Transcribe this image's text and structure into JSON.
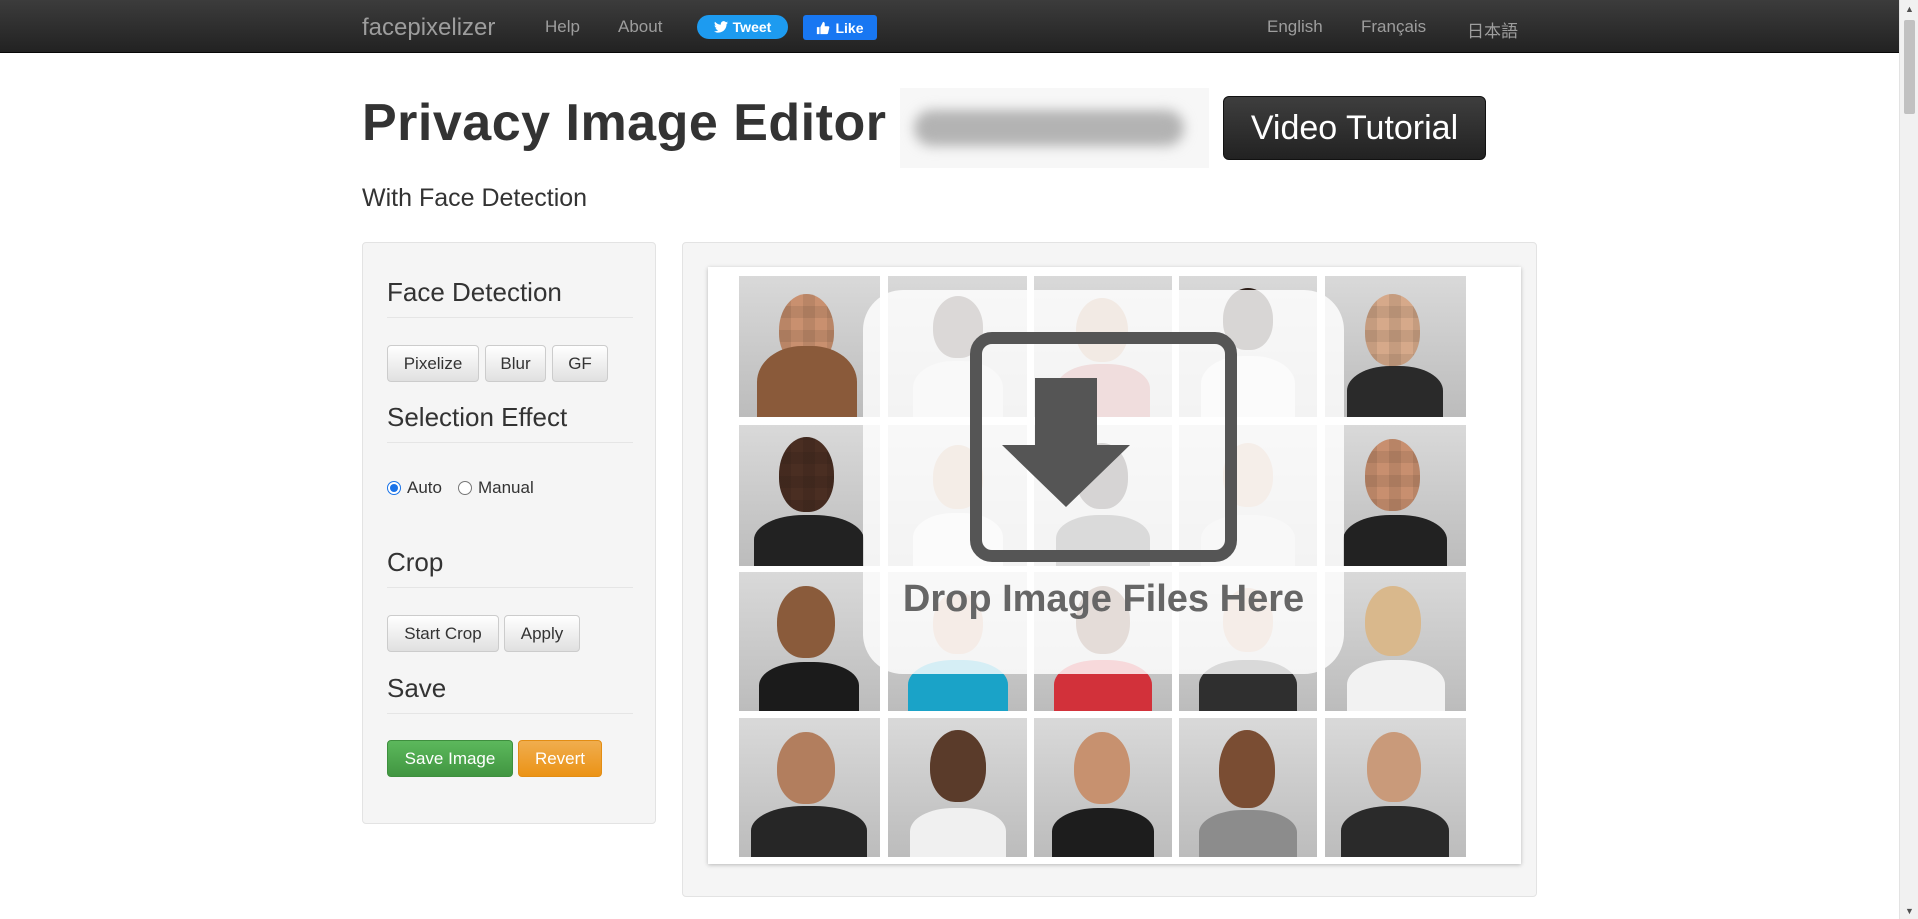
{
  "navbar": {
    "brand": "facepixelizer",
    "links": [
      "Help",
      "About"
    ],
    "tweet_label": "Tweet",
    "like_label": "Like",
    "languages": [
      "English",
      "Français",
      "日本語"
    ]
  },
  "header": {
    "title": "Privacy Image Editor &",
    "video_button": "Video Tutorial",
    "subtitle": "With Face Detection"
  },
  "sidebar": {
    "face_detection": {
      "title": "Face Detection",
      "buttons": [
        "Pixelize",
        "Blur",
        "GF"
      ]
    },
    "selection_effect": {
      "title": "Selection Effect",
      "options": [
        "Auto",
        "Manual"
      ],
      "selected": "Auto"
    },
    "crop": {
      "title": "Crop",
      "buttons": [
        "Start Crop",
        "Apply"
      ]
    },
    "save": {
      "title": "Save",
      "save_button": "Save Image",
      "revert_button": "Revert"
    }
  },
  "dropzone": {
    "label": "Drop Image Files Here",
    "icon": "download-arrow-icon"
  },
  "colors": {
    "navbar": "#222222",
    "tweet": "#1d9bf0",
    "like": "#1877f2",
    "save": "#5cb85c",
    "revert": "#f0ad4e"
  }
}
